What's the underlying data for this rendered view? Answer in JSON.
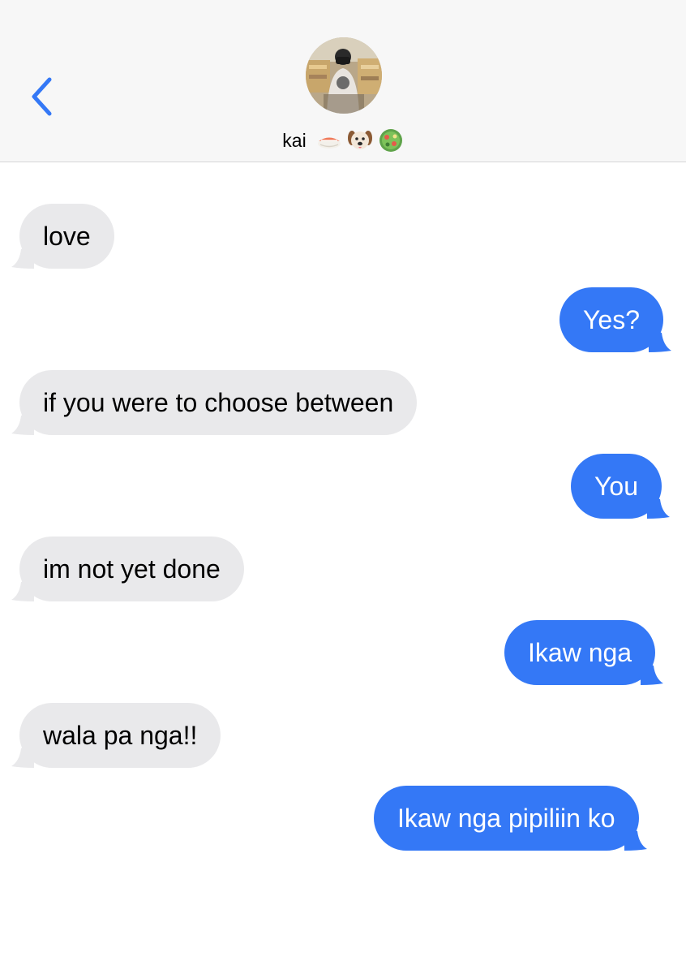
{
  "header": {
    "contact_name": "kai",
    "avatar_icon": "avatar-photo",
    "back_icon": "chevron-left-icon",
    "emoji_icons": [
      "sushi-icon",
      "dog-face-icon",
      "salad-icon"
    ],
    "accent_color": "#3478f6"
  },
  "messages": [
    {
      "direction": "received",
      "text": "love"
    },
    {
      "direction": "sent",
      "text": "Yes?"
    },
    {
      "direction": "received",
      "text": "if you were to choose between"
    },
    {
      "direction": "sent",
      "text": "You"
    },
    {
      "direction": "received",
      "text": "im not yet done"
    },
    {
      "direction": "sent",
      "text": "Ikaw nga"
    },
    {
      "direction": "received",
      "text": "wala pa nga!!"
    },
    {
      "direction": "sent",
      "text": "Ikaw nga pipiliin ko"
    }
  ],
  "colors": {
    "sent_bubble": "#3478f6",
    "received_bubble": "#e9e9eb",
    "header_background": "#f7f7f7"
  }
}
